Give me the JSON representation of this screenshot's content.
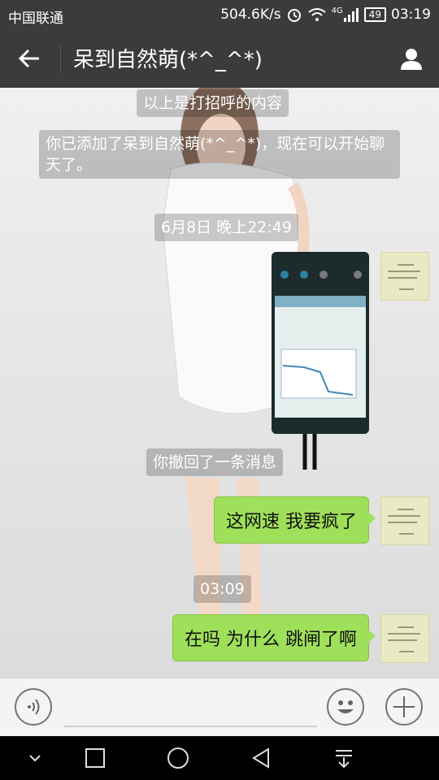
{
  "status_bar": {
    "carrier": "中国联通",
    "network_speed": "504.6K/s",
    "signal_label": "4G",
    "battery": "49",
    "time": "03:19"
  },
  "title_bar": {
    "title": "呆到自然萌(*^_^*)"
  },
  "messages": {
    "system_greeting": "以上是打招呼的内容",
    "system_added": "你已添加了呆到自然萌(*^_^*)，现在可以开始聊天了。",
    "timestamp_1": "6月8日 晚上22:49",
    "recalled": "你撤回了一条消息",
    "sent_1": "这网速  我要疯了",
    "timestamp_2": "03:09",
    "sent_2": "在吗   为什么  跳闸了啊"
  },
  "colors": {
    "bar_bg": "#3b3b3b",
    "sent_bubble": "#9fe05a"
  }
}
